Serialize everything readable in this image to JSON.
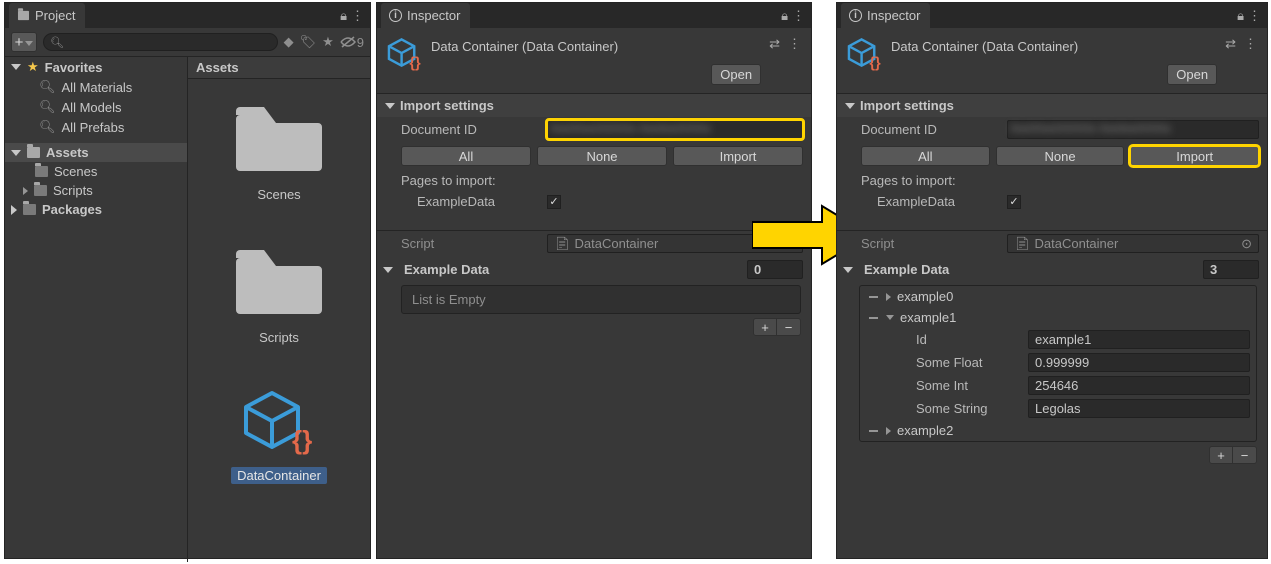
{
  "project": {
    "tab": "Project",
    "search_placeholder": "",
    "hidden_count": "9",
    "favorites": {
      "label": "Favorites",
      "items": [
        "All Materials",
        "All Models",
        "All Prefabs"
      ]
    },
    "assets": {
      "label": "Assets",
      "children": [
        "Scenes",
        "Scripts"
      ]
    },
    "packages_label": "Packages",
    "grid_header": "Assets",
    "grid_items": [
      "Scenes",
      "Scripts",
      "DataContainer"
    ]
  },
  "inspector_left": {
    "tab": "Inspector",
    "asset_title": "Data Container (Data Container)",
    "open_btn": "Open",
    "import_settings": "Import settings",
    "doc_id_label": "Document ID",
    "doc_id_value": "",
    "btn_all": "All",
    "btn_none": "None",
    "btn_import": "Import",
    "pages_label": "Pages to import:",
    "page_example": "ExampleData",
    "script_label": "Script",
    "script_value": "DataContainer",
    "example_data_label": "Example Data",
    "example_data_count": "0",
    "list_empty": "List is Empty"
  },
  "inspector_right": {
    "tab": "Inspector",
    "asset_title": "Data Container (Data Container)",
    "open_btn": "Open",
    "import_settings": "Import settings",
    "doc_id_label": "Document ID",
    "doc_id_value": "",
    "btn_all": "All",
    "btn_none": "None",
    "btn_import": "Import",
    "pages_label": "Pages to import:",
    "page_example": "ExampleData",
    "script_label": "Script",
    "script_value": "DataContainer",
    "example_data_label": "Example Data",
    "example_data_count": "3",
    "items": [
      "example0",
      "example1",
      "example2"
    ],
    "expanded": {
      "Id_label": "Id",
      "Id": "example1",
      "float_label": "Some Float",
      "float": "0.999999",
      "int_label": "Some Int",
      "int": "254646",
      "string_label": "Some String",
      "string": "Legolas"
    }
  }
}
